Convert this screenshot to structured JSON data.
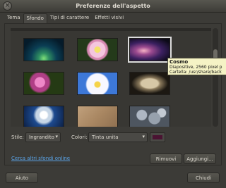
{
  "window": {
    "title": "Preferenze dell'aspetto"
  },
  "tabs": [
    {
      "label": "Tema",
      "active": false
    },
    {
      "label": "Sfondo",
      "active": true
    },
    {
      "label": "Tipi di carattere",
      "active": false
    },
    {
      "label": "Effetti visivi",
      "active": false
    }
  ],
  "tooltip": {
    "title": "Cosmo",
    "line1": "Diapositive, 2560 pixel p",
    "line2": "Cartella: /usr/share/back"
  },
  "controls": {
    "style_label": "Stile:",
    "style_value": "Ingrandito",
    "colors_label": "Colori:",
    "colors_value": "Tinta unita",
    "swatch_color": "#4a1332"
  },
  "link": {
    "label": "Cerca altri sfondi online"
  },
  "buttons": {
    "remove": "Rimuovi",
    "add": "Aggiungi...",
    "help": "Aiuto",
    "close": "Chiudi"
  }
}
